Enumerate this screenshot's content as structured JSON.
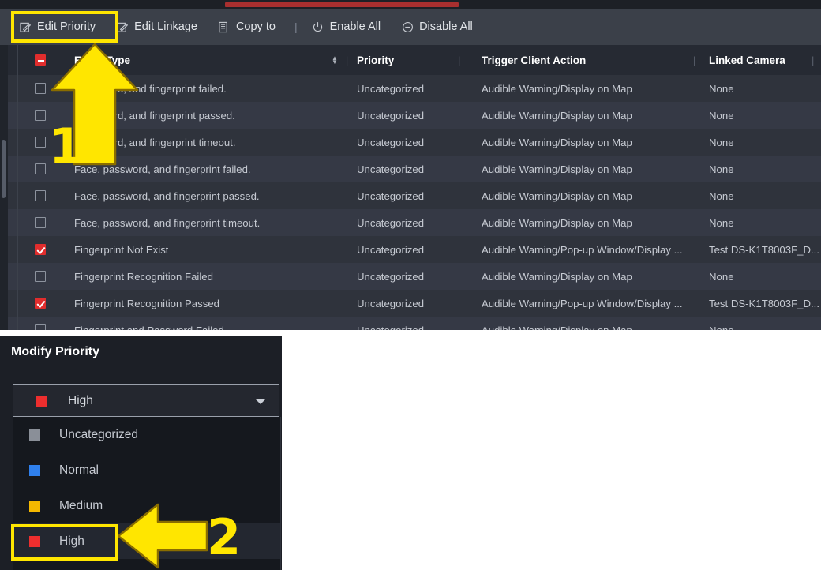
{
  "toolbar": {
    "buttons": [
      {
        "label": "Edit Priority",
        "icon": "edit-pencil-icon"
      },
      {
        "label": "Edit Linkage",
        "icon": "edit-pencil-icon"
      },
      {
        "label": "Copy to",
        "icon": "copy-document-icon"
      },
      {
        "label": "Enable All",
        "icon": "power-icon"
      },
      {
        "label": "Disable All",
        "icon": "minus-circle-icon"
      }
    ],
    "separator": "|"
  },
  "table": {
    "columns": [
      {
        "key": "event_type",
        "label": "Event Type",
        "sortable": true
      },
      {
        "key": "priority",
        "label": "Priority"
      },
      {
        "key": "trigger_client_action",
        "label": "Trigger Client Action"
      },
      {
        "key": "linked_camera",
        "label": "Linked Camera"
      }
    ],
    "header_checkbox_state": "indeterminate",
    "column_divider": "|",
    "rows": [
      {
        "checked": false,
        "event_type": "Face, card, and fingerprint failed.",
        "priority": "Uncategorized",
        "trigger_client_action": "Audible Warning/Display on Map",
        "linked_camera": "None"
      },
      {
        "checked": false,
        "event_type": "Face, card, and fingerprint passed.",
        "priority": "Uncategorized",
        "trigger_client_action": "Audible Warning/Display on Map",
        "linked_camera": "None"
      },
      {
        "checked": false,
        "event_type": "Face, card, and fingerprint timeout.",
        "priority": "Uncategorized",
        "trigger_client_action": "Audible Warning/Display on Map",
        "linked_camera": "None"
      },
      {
        "checked": false,
        "event_type": "Face, password, and fingerprint failed.",
        "priority": "Uncategorized",
        "trigger_client_action": "Audible Warning/Display on Map",
        "linked_camera": "None"
      },
      {
        "checked": false,
        "event_type": "Face, password, and fingerprint passed.",
        "priority": "Uncategorized",
        "trigger_client_action": "Audible Warning/Display on Map",
        "linked_camera": "None"
      },
      {
        "checked": false,
        "event_type": "Face, password, and fingerprint timeout.",
        "priority": "Uncategorized",
        "trigger_client_action": "Audible Warning/Display on Map",
        "linked_camera": "None"
      },
      {
        "checked": true,
        "event_type": "Fingerprint Not Exist",
        "priority": "Uncategorized",
        "trigger_client_action": "Audible Warning/Pop-up Window/Display ...",
        "linked_camera": "Test DS-K1T8003F_D..."
      },
      {
        "checked": false,
        "event_type": "Fingerprint Recognition Failed",
        "priority": "Uncategorized",
        "trigger_client_action": "Audible Warning/Display on Map",
        "linked_camera": "None"
      },
      {
        "checked": true,
        "event_type": "Fingerprint Recognition Passed",
        "priority": "Uncategorized",
        "trigger_client_action": "Audible Warning/Pop-up Window/Display ...",
        "linked_camera": "Test DS-K1T8003F_D..."
      },
      {
        "checked": false,
        "event_type": "Fingerprint and Password Failed",
        "priority": "Uncategorized",
        "trigger_client_action": "Audible Warning/Display on Map",
        "linked_camera": "None"
      }
    ]
  },
  "dialog": {
    "title": "Modify Priority",
    "selected": {
      "label": "High",
      "color": "#ed2e2e"
    },
    "options": [
      {
        "label": "Uncategorized",
        "color": "#8a8f98",
        "selected": false
      },
      {
        "label": "Normal",
        "color": "#2f80ed",
        "selected": false
      },
      {
        "label": "Medium",
        "color": "#f5b800",
        "selected": false
      },
      {
        "label": "High",
        "color": "#ed2e2e",
        "selected": true
      }
    ]
  },
  "annotations": {
    "step_one": "1",
    "step_two": "2",
    "highlight_color": "#ffe600"
  },
  "colors": {
    "toolbar_bg": "#3b4049",
    "table_header_bg": "#262a33",
    "row_bg": "#2f333c",
    "row_alt_bg": "#353945",
    "dialog_bg": "#1c1f26",
    "accent_red": "#e12d2d",
    "annotation_yellow": "#ffe600"
  }
}
